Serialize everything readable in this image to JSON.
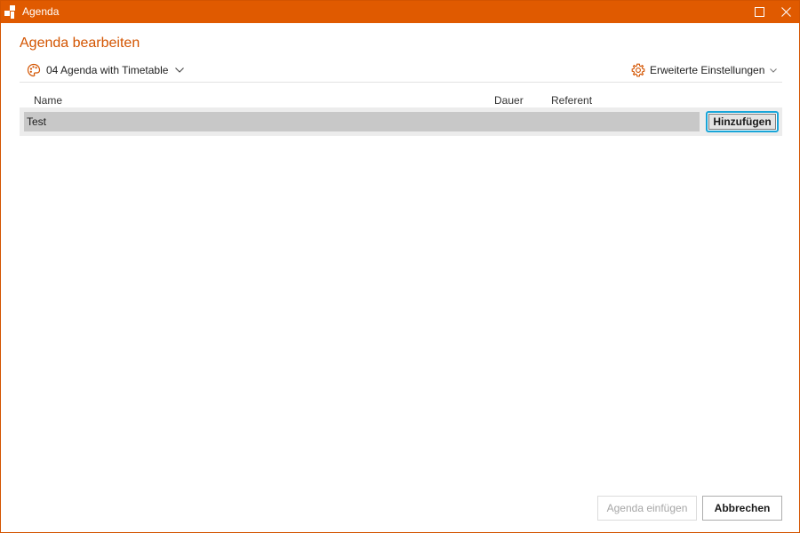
{
  "window": {
    "title": "Agenda",
    "accent_color": "#e05a00",
    "title_icons": [
      "app-logo-icon",
      "maximize-icon",
      "close-icon"
    ]
  },
  "heading": "Agenda bearbeiten",
  "template": {
    "label": "04 Agenda with Timetable",
    "icon": "palette-icon"
  },
  "settings": {
    "label": "Erweiterte Einstellungen",
    "icon": "gear-icon"
  },
  "columns": [
    "Name",
    "Dauer",
    "Referent"
  ],
  "new_item": {
    "name_value": "Test",
    "add_label": "Hinzufügen"
  },
  "footer": {
    "insert_label": "Agenda einfügen",
    "cancel_label": "Abbrechen"
  }
}
